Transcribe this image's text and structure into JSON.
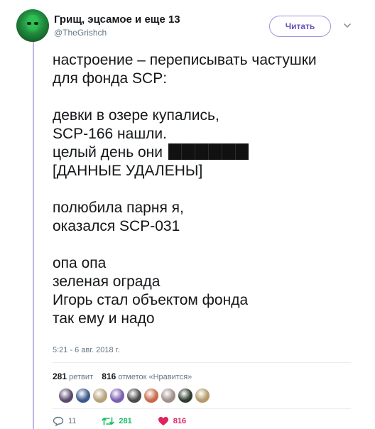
{
  "author": {
    "display_name": "Грищ, эцсамое и еще 13",
    "handle": "@TheGrishch"
  },
  "follow_button": {
    "label": "Читать"
  },
  "tweet": {
    "lines": [
      "настроение – переписывать частушки",
      "для фонда SCP:",
      "",
      "девки в озере купались,",
      "SCP-166 нашли.",
      "целый день они",
      "[ДАННЫЕ УДАЛЕНЫ]",
      "",
      "полюбила парня я,",
      "оказался SCP-031",
      "",
      "опа опа",
      "зеленая ограда",
      "Игорь стал объектом фонда",
      "так ему и надо"
    ],
    "timestamp": "5:21 - 6 авг. 2018 г."
  },
  "stats": {
    "retweets_count": "281",
    "retweets_label": "ретвит",
    "likes_count": "816",
    "likes_label": "отметок «Нравится»"
  },
  "likers": [
    "#5a4a6e",
    "#3a5a8c",
    "#b7a27a",
    "#7a5fb0",
    "#4a4a4a",
    "#c86a4a",
    "#a0908a",
    "#2e3b2e",
    "#b59a6a"
  ],
  "actions": {
    "reply_count": "11",
    "retweet_count": "281",
    "like_count": "816"
  },
  "colors": {
    "accent": "#6d4fc2",
    "retweet": "#17bf63",
    "like": "#e0245e",
    "thread_line": "#c4b3e8"
  }
}
